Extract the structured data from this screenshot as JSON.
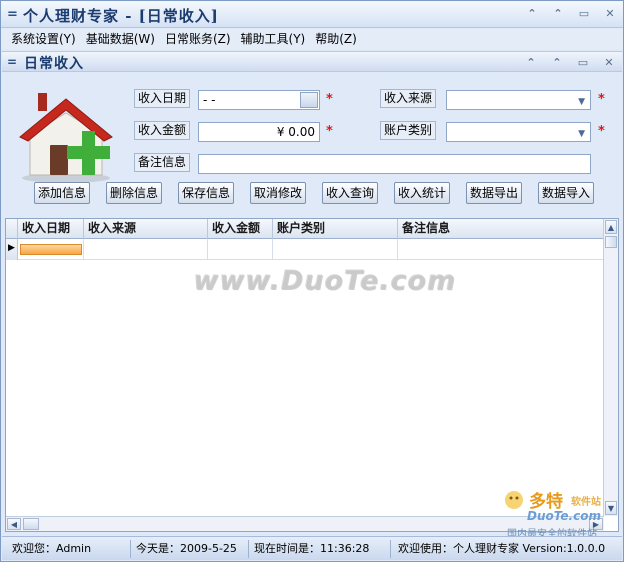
{
  "app": {
    "title": "个人理财专家 - [日常收入]",
    "window_buttons": [
      "⌃",
      "⌃",
      "▭",
      "✕"
    ]
  },
  "menu": {
    "items": [
      "系统设置(Y)",
      "基础数据(W)",
      "日常账务(Z)",
      "辅助工具(Y)",
      "帮助(Z)"
    ]
  },
  "child_window": {
    "title": "日常收入",
    "buttons": [
      "⌃",
      "⌃",
      "▭",
      "✕"
    ]
  },
  "form": {
    "labels": {
      "income_date": "收入日期",
      "income_amount": "收入金额",
      "remark": "备注信息",
      "income_source": "收入来源",
      "account_type": "账户类别"
    },
    "values": {
      "income_date": " -  -",
      "income_amount": "¥ 0.00",
      "remark": "",
      "income_source": "",
      "account_type": ""
    },
    "required_mark": "*"
  },
  "buttons": [
    "添加信息",
    "删除信息",
    "保存信息",
    "取消修改",
    "收入查询",
    "收入统计",
    "数据导出",
    "数据导入"
  ],
  "grid": {
    "columns": [
      "收入日期",
      "收入来源",
      "收入金额",
      "账户类别",
      "备注信息"
    ],
    "row_indicator": "▶"
  },
  "status": {
    "welcome_user": "欢迎您：Admin",
    "today": "今天是：2009-5-25",
    "time": "现在时间是：11:36:28",
    "version": "欢迎使用：个人理财专家 Version:1.0.0.0"
  },
  "watermark": {
    "main": "www.DuoTe.com",
    "logo_title": "多特",
    "logo_sub": "软件站",
    "logo_domain": "DuoTe.com",
    "logo_slogan": "国内最安全的软件站"
  },
  "colors": {
    "accent": "#1c3b6e",
    "required": "#d02020",
    "selection": "#f5a545",
    "window_bg": "#dfe9f7"
  }
}
